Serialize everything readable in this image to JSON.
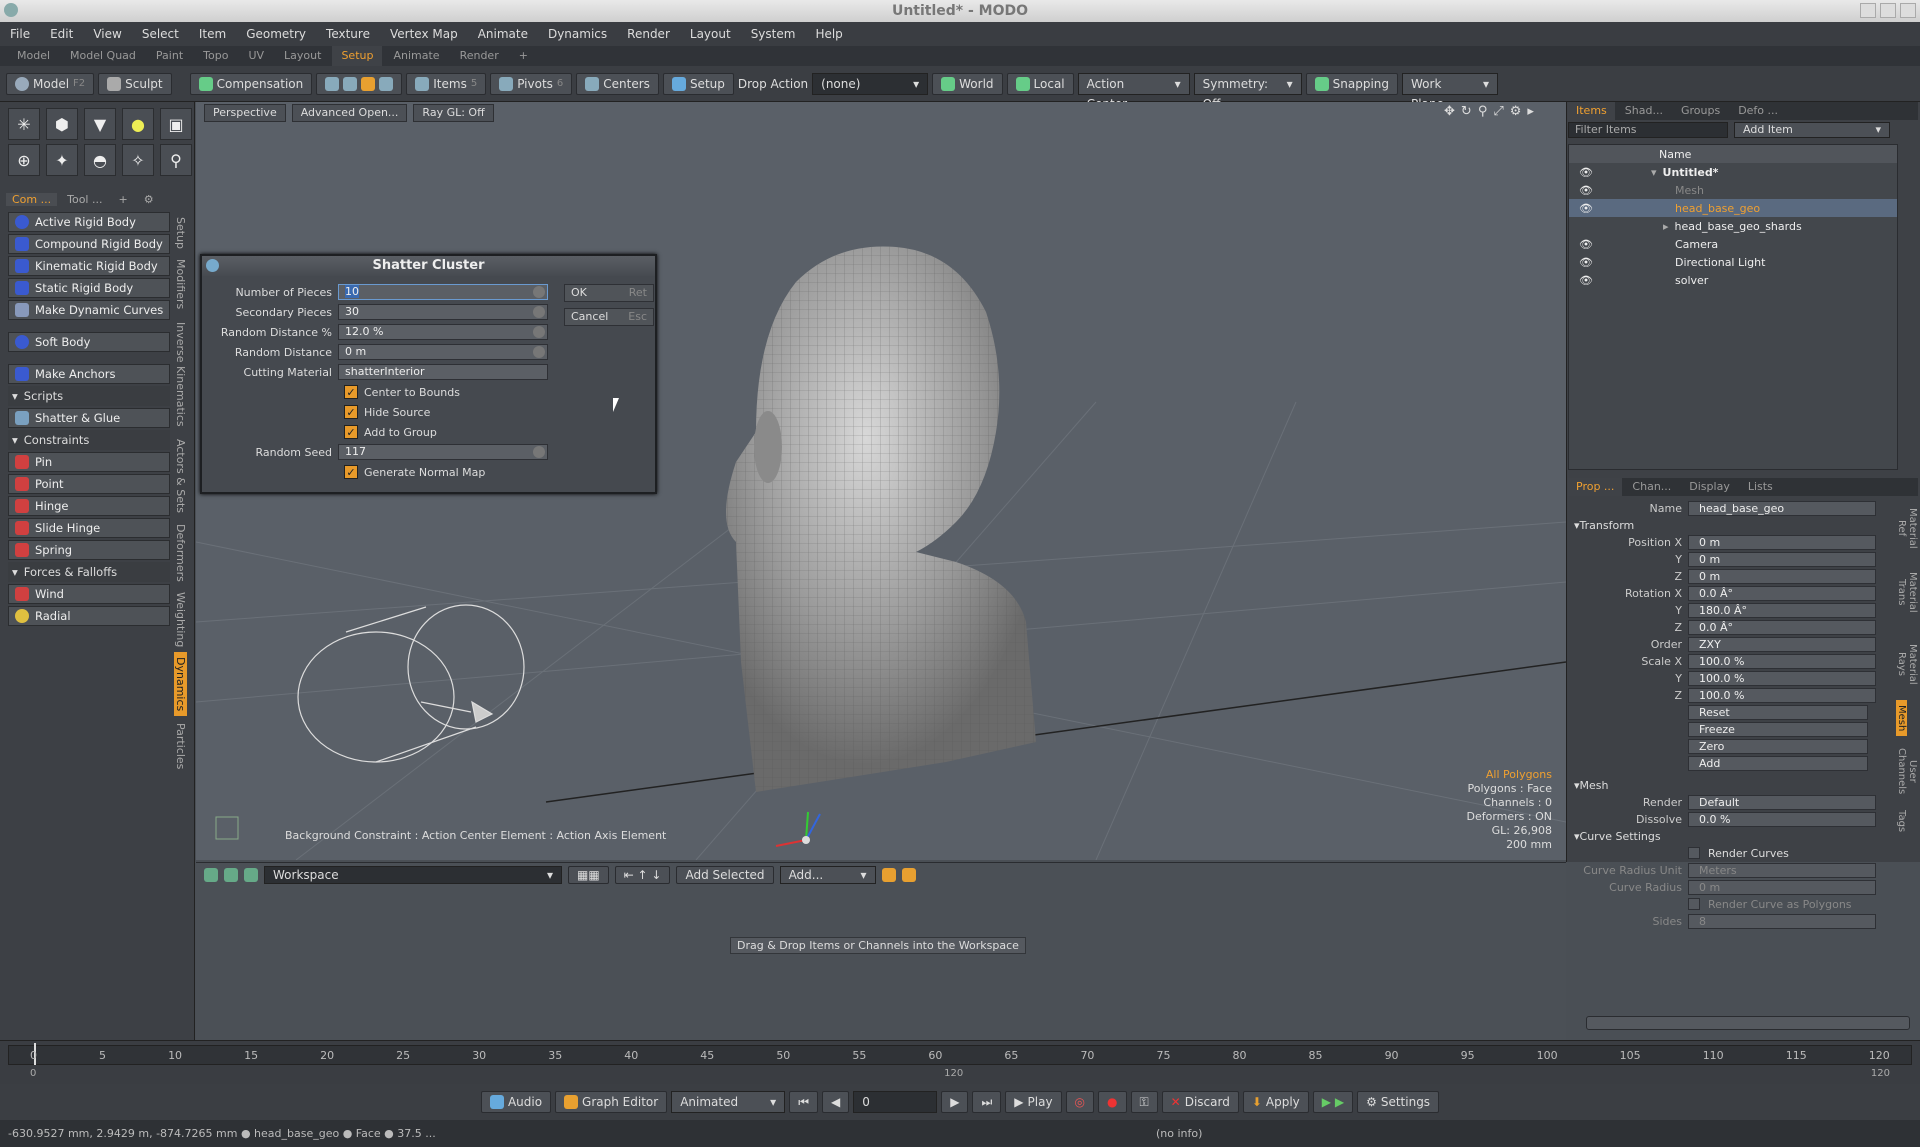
{
  "window": {
    "title": "Untitled* - MODO"
  },
  "menu": [
    "File",
    "Edit",
    "View",
    "Select",
    "Item",
    "Geometry",
    "Texture",
    "Vertex Map",
    "Animate",
    "Dynamics",
    "Render",
    "Layout",
    "System",
    "Help"
  ],
  "layout_tabs": [
    "Model",
    "Model Quad",
    "Paint",
    "Topo",
    "UV",
    "Layout",
    "Setup",
    "Animate",
    "Render",
    "+"
  ],
  "active_layout_tab": "Setup",
  "toolbar": {
    "model": "Model",
    "model_key": "F2",
    "sculpt": "Sculpt",
    "compensation": "Compensation",
    "items": "Items",
    "items_count": "5",
    "pivots": "Pivots",
    "pivots_count": "6",
    "centers": "Centers",
    "setup": "Setup",
    "drop_action_label": "Drop Action",
    "drop_action_value": "(none)",
    "world": "World",
    "local": "Local",
    "action_center": "Action Center",
    "symmetry": "Symmetry: Off",
    "snapping": "Snapping",
    "work_plane": "Work Plane"
  },
  "left_tabs": [
    "Com ...",
    "Tool ..."
  ],
  "left_list": [
    {
      "type": "item",
      "label": "Active Rigid Body",
      "color": "#3a5ad0"
    },
    {
      "type": "item",
      "label": "Compound Rigid Body",
      "color": "#3a5ad0"
    },
    {
      "type": "item",
      "label": "Kinematic Rigid Body",
      "color": "#3a5ad0"
    },
    {
      "type": "item",
      "label": "Static Rigid Body",
      "color": "#3a5ad0"
    },
    {
      "type": "item",
      "label": "Make Dynamic Curves",
      "color": "#8899bb"
    },
    {
      "type": "item",
      "label": "Soft Body",
      "color": "#3a5ad0"
    },
    {
      "type": "item",
      "label": "Make Anchors",
      "color": "#3a5ad0"
    },
    {
      "type": "head",
      "label": "Scripts"
    },
    {
      "type": "item",
      "label": "Shatter & Glue",
      "color": "#7aa0c0"
    },
    {
      "type": "head",
      "label": "Constraints"
    },
    {
      "type": "item",
      "label": "Pin",
      "color": "#d04040"
    },
    {
      "type": "item",
      "label": "Point",
      "color": "#d04040"
    },
    {
      "type": "item",
      "label": "Hinge",
      "color": "#d04040"
    },
    {
      "type": "item",
      "label": "Slide Hinge",
      "color": "#d04040"
    },
    {
      "type": "item",
      "label": "Spring",
      "color": "#d04040"
    },
    {
      "type": "head",
      "label": "Forces & Falloffs"
    },
    {
      "type": "item",
      "label": "Wind",
      "color": "#d04040"
    },
    {
      "type": "item",
      "label": "Radial",
      "color": "#e0c040"
    }
  ],
  "vertical_tabs": [
    "Setup",
    "Modifiers",
    "Inverse Kinematics",
    "Actors & Sets",
    "Deformers",
    "Weighting",
    "Dynamics",
    "Particles"
  ],
  "active_vertical_tab": "Dynamics",
  "viewport": {
    "buttons": [
      "Perspective",
      "Advanced Open...",
      "Ray GL: Off"
    ],
    "status": [
      "All Polygons",
      "Polygons : Face",
      "Channels : 0",
      "Deformers : ON",
      "GL: 26,908",
      "200 mm"
    ],
    "hint": "Background Constraint   : Action Center Element  : Action Axis Element"
  },
  "dialog": {
    "title": "Shatter Cluster",
    "fields": [
      {
        "label": "Number of Pieces",
        "value": "10"
      },
      {
        "label": "Secondary Pieces",
        "value": "30"
      },
      {
        "label": "Random Distance %",
        "value": "12.0 %"
      },
      {
        "label": "Random Distance",
        "value": "0 m"
      },
      {
        "label": "Cutting Material",
        "value": "shatterInterior"
      }
    ],
    "checks": [
      "Center to Bounds",
      "Hide Source",
      "Add to Group"
    ],
    "seed_label": "Random Seed",
    "seed_value": "117",
    "normal_map": "Generate Normal Map",
    "ok": "OK",
    "ok_key": "Ret",
    "cancel": "Cancel",
    "cancel_key": "Esc"
  },
  "workspace": {
    "dropdown": "Workspace",
    "add_selected": "Add Selected",
    "add": "Add...",
    "hint": "Drag & Drop Items or Channels into the Workspace"
  },
  "items_panel": {
    "tabs": [
      "Items",
      "Shad...",
      "Groups",
      "Defo ..."
    ],
    "filter_placeholder": "Filter Items",
    "add_item": "Add Item",
    "col_name": "Name",
    "tree": [
      {
        "label": "Untitled*",
        "indent": 0,
        "bold": true
      },
      {
        "label": "Mesh",
        "indent": 1,
        "dim": true
      },
      {
        "label": "head_base_geo",
        "indent": 1,
        "selected": true
      },
      {
        "label": "head_base_geo_shards",
        "indent": 1
      },
      {
        "label": "Camera",
        "indent": 1
      },
      {
        "label": "Directional Light",
        "indent": 1
      },
      {
        "label": "solver",
        "indent": 1
      }
    ]
  },
  "props_panel": {
    "tabs": [
      "Prop ...",
      "Chan...",
      "Display",
      "Lists"
    ],
    "name_label": "Name",
    "name_value": "head_base_geo",
    "transform": "Transform",
    "position": [
      [
        "Position X",
        "0 m"
      ],
      [
        "Y",
        "0 m"
      ],
      [
        "Z",
        "0 m"
      ]
    ],
    "rotation": [
      [
        "Rotation X",
        "0.0 Â°"
      ],
      [
        "Y",
        "180.0 Â°"
      ],
      [
        "Z",
        "0.0 Â°"
      ]
    ],
    "order_label": "Order",
    "order_value": "ZXY",
    "scale": [
      [
        "Scale X",
        "100.0 %"
      ],
      [
        "Y",
        "100.0 %"
      ],
      [
        "Z",
        "100.0 %"
      ]
    ],
    "actions": [
      "Reset",
      "Freeze",
      "Zero",
      "Add"
    ],
    "mesh": "Mesh",
    "render_label": "Render",
    "render_value": "Default",
    "dissolve_label": "Dissolve",
    "dissolve_value": "0.0 %",
    "curve_settings": "Curve Settings",
    "render_curves": "Render Curves",
    "curve_radius_unit_label": "Curve Radius Unit",
    "curve_radius_unit_value": "Meters",
    "curve_radius_label": "Curve Radius",
    "curve_radius_value": "0 m",
    "render_as_polys": "Render Curve as Polygons",
    "sides_label": "Sides",
    "sides_value": "8",
    "side_tabs": [
      "Material Ref",
      "Material Trans",
      "Material Rays",
      "Mesh",
      "User Channels",
      "Tags"
    ]
  },
  "timeline": {
    "ticks": [
      "0",
      "5",
      "10",
      "15",
      "20",
      "25",
      "30",
      "35",
      "40",
      "45",
      "50",
      "55",
      "60",
      "65",
      "70",
      "75",
      "80",
      "85",
      "90",
      "95",
      "100",
      "105",
      "110",
      "115",
      "120"
    ],
    "start": "0",
    "mid": "120",
    "end": "120"
  },
  "transport": {
    "audio": "Audio",
    "graph_editor": "Graph Editor",
    "animated": "Animated",
    "frame": "0",
    "play": "Play",
    "discard": "Discard",
    "apply": "Apply",
    "settings": "Settings"
  },
  "status": {
    "left": "-630.9527 mm, 2.9429 m, -874.7265 mm ● head_base_geo ● Face ● 37.5 ...",
    "center": "(no info)"
  }
}
